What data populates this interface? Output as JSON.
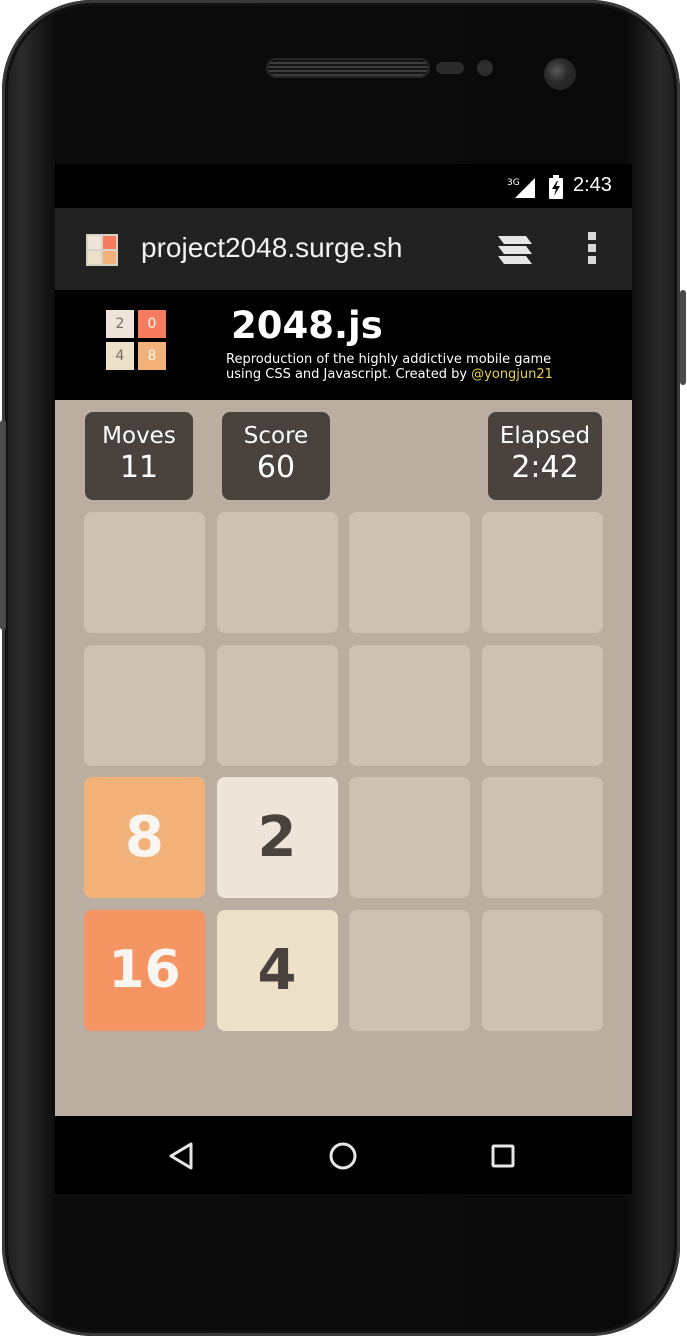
{
  "statusbar": {
    "network": "3G",
    "time": "2:43"
  },
  "browser": {
    "url": "project2048.surge.sh",
    "favicon_icon": "2048-favicon-icon",
    "tabs_icon": "tabs-stack-icon",
    "menu_icon": "overflow-menu-icon"
  },
  "header": {
    "logo_tiles": [
      {
        "value": "2",
        "color": "#eee4da",
        "text_color": "#776e65"
      },
      {
        "value": "0",
        "color": "#f67c5f",
        "text_color": "#f9f6f2"
      },
      {
        "value": "4",
        "color": "#ede0c8",
        "text_color": "#776e65"
      },
      {
        "value": "8",
        "color": "#f2b179",
        "text_color": "#f9f6f2"
      }
    ],
    "title": "2048.js",
    "desc_line1": "Reproduction of the highly addictive mobile game",
    "desc_line2": "using CSS and Javascript. Created by ",
    "author": "@yongjun21"
  },
  "stats": {
    "moves_label": "Moves",
    "moves_value": "11",
    "score_label": "Score",
    "score_value": "60",
    "elapsed_label": "Elapsed",
    "elapsed_value": "2:42"
  },
  "board": {
    "rows": [
      [
        "",
        "",
        "",
        ""
      ],
      [
        "",
        "",
        "",
        ""
      ],
      [
        "8",
        "2",
        "",
        ""
      ],
      [
        "16",
        "4",
        "",
        ""
      ]
    ]
  },
  "colors": {
    "game_bg": "#bbada0",
    "empty_cell": "#cdc1b4",
    "tile_2": "#eee4da",
    "tile_4": "#ede0c8",
    "tile_8": "#f2b179",
    "tile_16": "#f59563",
    "dark_text": "#4a423d",
    "light_text": "#f9f6f2",
    "stat_bg": "#4a423d"
  },
  "navbar": {
    "back_icon": "back-triangle-icon",
    "home_icon": "home-circle-icon",
    "recents_icon": "recents-square-icon"
  }
}
